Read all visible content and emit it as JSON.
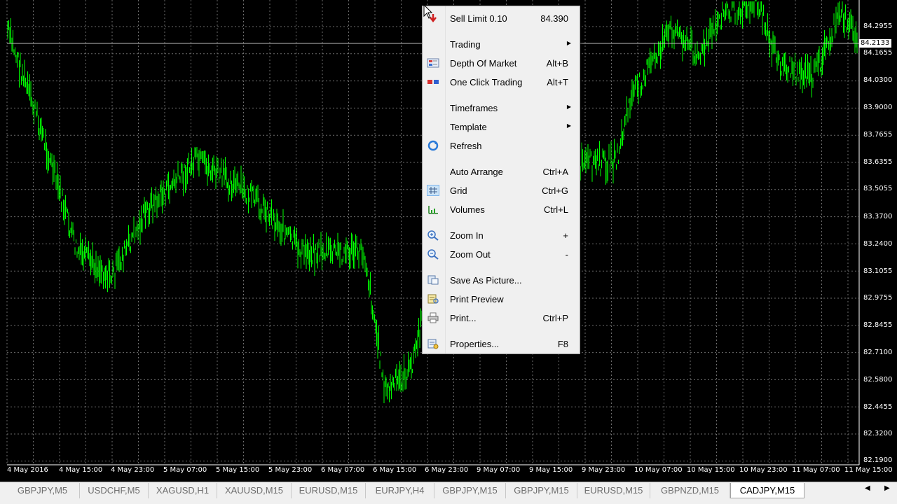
{
  "chart": {
    "symbol": "CADJPY,M15",
    "current_price": "84.2133",
    "price_axis": [
      "84.2955",
      "84.1655",
      "84.0300",
      "83.9000",
      "83.7655",
      "83.6355",
      "83.5055",
      "83.3700",
      "83.2400",
      "83.1055",
      "82.9755",
      "82.8455",
      "82.7100",
      "82.5800",
      "82.4455",
      "82.3200",
      "82.1900"
    ],
    "time_axis": [
      "4 May 2016",
      "4 May 15:00",
      "4 May 23:00",
      "5 May 07:00",
      "5 May 15:00",
      "5 May 23:00",
      "6 May 07:00",
      "6 May 15:00",
      "6 May 23:00",
      "9 May 07:00",
      "9 May 15:00",
      "9 May 23:00",
      "10 May 07:00",
      "10 May 15:00",
      "10 May 23:00",
      "11 May 07:00",
      "11 May 15:00"
    ],
    "colors": {
      "background": "#000000",
      "bars": "#00ff00",
      "grid": "#6b6b6b"
    }
  },
  "context_menu": {
    "items": [
      {
        "label": "Sell Limit 0.10",
        "shortcut": "84.390",
        "icon": "sell-limit-icon"
      },
      {
        "label": "Trading",
        "submenu": true
      },
      {
        "label": "Depth Of Market",
        "shortcut": "Alt+B",
        "icon": "depth-of-market-icon"
      },
      {
        "label": "One Click Trading",
        "shortcut": "Alt+T",
        "icon": "one-click-trading-icon"
      },
      {
        "label": "Timeframes",
        "submenu": true
      },
      {
        "label": "Template",
        "submenu": true
      },
      {
        "label": "Refresh",
        "icon": "refresh-icon"
      },
      {
        "label": "Auto Arrange",
        "shortcut": "Ctrl+A"
      },
      {
        "label": "Grid",
        "shortcut": "Ctrl+G",
        "icon": "grid-icon",
        "checked": true
      },
      {
        "label": "Volumes",
        "shortcut": "Ctrl+L",
        "icon": "volumes-icon"
      },
      {
        "label": "Zoom In",
        "shortcut": "+",
        "icon": "zoom-in-icon"
      },
      {
        "label": "Zoom Out",
        "shortcut": "-",
        "icon": "zoom-out-icon"
      },
      {
        "label": "Save As Picture...",
        "icon": "save-picture-icon"
      },
      {
        "label": "Print Preview",
        "icon": "print-preview-icon"
      },
      {
        "label": "Print...",
        "shortcut": "Ctrl+P",
        "icon": "printer-icon"
      },
      {
        "label": "Properties...",
        "shortcut": "F8",
        "icon": "properties-icon"
      }
    ]
  },
  "tabs": [
    "GBPJPY,M5",
    "USDCHF,M5",
    "XAGUSD,H1",
    "XAUUSD,M15",
    "EURUSD,M15",
    "EURJPY,H4",
    "GBPJPY,M15",
    "GBPJPY,M15",
    "EURUSD,M15",
    "GBPNZD,M15",
    "CADJPY,M15"
  ],
  "active_tab": "CADJPY,M15"
}
